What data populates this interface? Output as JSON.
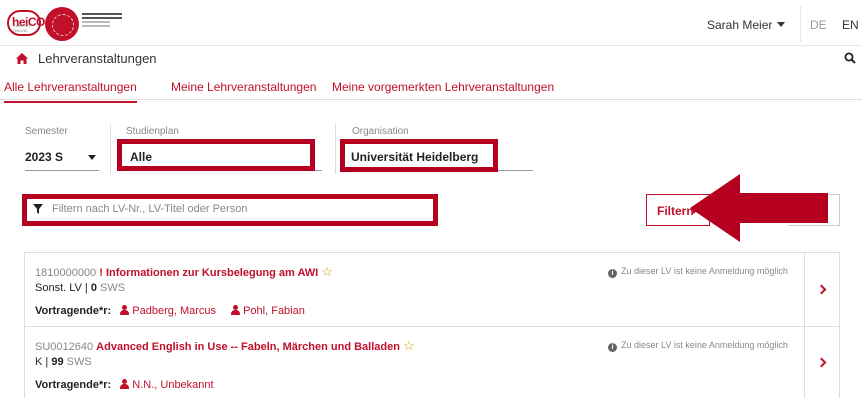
{
  "header": {
    "logo_text": "heiCO",
    "logo_subtext": "CAMPUS ONLINE",
    "user_name": "Sarah Meier",
    "lang_de": "DE",
    "lang_en": "EN"
  },
  "page": {
    "title": "Lehrveranstaltungen"
  },
  "tabs": [
    {
      "label": "Alle Lehrveranstaltungen",
      "active": true
    },
    {
      "label": "Meine Lehrveranstaltungen",
      "active": false
    },
    {
      "label": "Meine vorgemerkten Lehrveranstaltungen",
      "active": false
    }
  ],
  "filters": {
    "semester": {
      "label": "Semester",
      "value": "2023 S"
    },
    "studienplan": {
      "label": "Studienplan",
      "value": "Alle"
    },
    "organisation": {
      "label": "Organisation",
      "value": "Universität Heidelberg"
    },
    "search_placeholder": "Filtern nach LV-Nr., LV-Titel oder Person",
    "filter_button": "Filtern"
  },
  "courses": [
    {
      "number": "1810000000",
      "title": "! Informationen zur Kursbelegung am AWI",
      "type": "Sonst. LV |",
      "sws_value": "0",
      "sws_unit": "SWS",
      "notice": "Zu dieser LV ist keine Anmeldung möglich",
      "lecturers_label": "Vortragende*r:",
      "lecturers": [
        "Padberg, Marcus",
        "Pohl, Fabian"
      ]
    },
    {
      "number": "SU0012640",
      "title": "Advanced English in Use -- Fabeln, Märchen und Balladen",
      "type": "K |",
      "sws_value": "99",
      "sws_unit": "SWS",
      "notice": "Zu dieser LV ist keine Anmeldung möglich",
      "lecturers_label": "Vortragende*r:",
      "lecturers": [
        "N.N., Unbekannt"
      ]
    }
  ],
  "colors": {
    "accent": "#c0102a",
    "highlight_box": "#b5001f"
  }
}
